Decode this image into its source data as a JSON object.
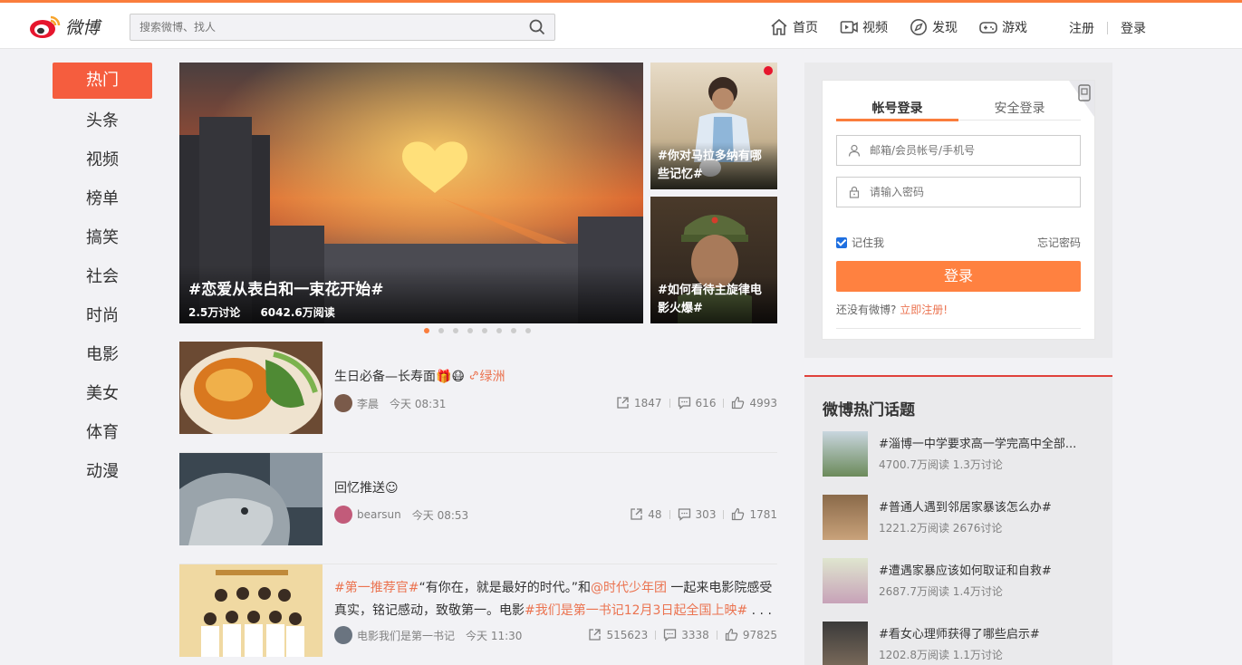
{
  "header": {
    "logo_text": "微博",
    "search_placeholder": "搜索微博、找人",
    "nav": [
      {
        "label": "首页",
        "icon": "home-icon"
      },
      {
        "label": "视频",
        "icon": "video-icon"
      },
      {
        "label": "发现",
        "icon": "compass-icon"
      },
      {
        "label": "游戏",
        "icon": "gamepad-icon"
      }
    ],
    "register": "注册",
    "login": "登录"
  },
  "categories": [
    "热门",
    "头条",
    "视频",
    "榜单",
    "搞笑",
    "社会",
    "时尚",
    "电影",
    "美女",
    "体育",
    "动漫"
  ],
  "carousel": {
    "main": {
      "title": "#恋爱从表白和一束花开始#",
      "discuss": "2.5万讨论",
      "reads": "6042.6万阅读"
    },
    "side": [
      {
        "title": "#你对马拉多纳有哪些记忆#"
      },
      {
        "title": "#如何看待主旋律电影火爆#"
      }
    ],
    "dot_count": 8,
    "active_dot": 0
  },
  "feed": [
    {
      "title": "生日必备—长寿面🎁😷",
      "location": "绿洲",
      "author": "李晨",
      "time": "今天 08:31",
      "shares": "1847",
      "comments": "616",
      "likes": "4993"
    },
    {
      "title": "回忆推送☺",
      "author": "bearsun",
      "time": "今天 08:53",
      "shares": "48",
      "comments": "303",
      "likes": "1781"
    },
    {
      "title_parts": [
        "#第一推荐官#",
        "“有你在，就是最好的时代。”和",
        "@时代少年团",
        " 一起来电影院感受真实，铭记感动，致敬第一。电影",
        "#我们是第一书记12月3日起全国上映#",
        " . . ."
      ],
      "author": "电影我们是第一书记",
      "time": "今天 11:30",
      "shares": "515623",
      "comments": "3338",
      "likes": "97825"
    }
  ],
  "login": {
    "tab_account": "帐号登录",
    "tab_secure": "安全登录",
    "user_placeholder": "邮箱/会员帐号/手机号",
    "pass_placeholder": "请输入密码",
    "remember": "记住我",
    "forgot": "忘记密码",
    "button": "登录",
    "no_account": "还没有微博?",
    "register_now": "立即注册!"
  },
  "topics": {
    "heading": "微博热门话题",
    "items": [
      {
        "name": "#淄博一中学要求高一学完高中全部...",
        "meta": "4700.7万阅读 1.3万讨论"
      },
      {
        "name": "#普通人遇到邻居家暴该怎么办#",
        "meta": "1221.2万阅读 2676讨论"
      },
      {
        "name": "#遭遇家暴应该如何取证和自救#",
        "meta": "2687.7万阅读 1.4万讨论"
      },
      {
        "name": "#看女心理师获得了哪些启示#",
        "meta": "1202.8万阅读 1.1万讨论"
      }
    ]
  },
  "colors": {
    "accent": "#fa7d3c",
    "active_category": "#f55d3e",
    "link": "#eb7350",
    "login_button": "#ff8140"
  }
}
